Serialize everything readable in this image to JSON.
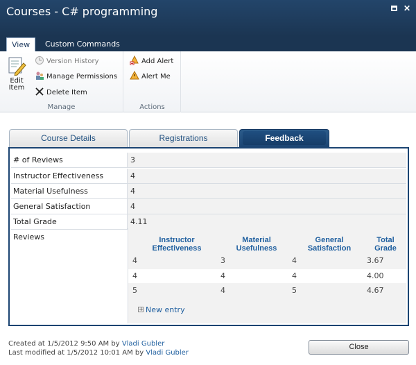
{
  "window": {
    "title": "Courses - C# programming"
  },
  "ribbon": {
    "tabs": [
      {
        "label": "View"
      },
      {
        "label": "Custom Commands"
      }
    ],
    "manage": {
      "edit_item": "Edit Item",
      "version_history": "Version History",
      "manage_permissions": "Manage Permissions",
      "delete_item": "Delete Item",
      "group_label": "Manage"
    },
    "actions": {
      "add_alert": "Add Alert",
      "alert_me": "Alert Me",
      "group_label": "Actions"
    }
  },
  "content_tabs": [
    {
      "label": "Course Details"
    },
    {
      "label": "Registrations"
    },
    {
      "label": "Feedback"
    }
  ],
  "fields": [
    {
      "label": "# of Reviews",
      "value": "3"
    },
    {
      "label": "Instructor Effectiveness",
      "value": "4"
    },
    {
      "label": "Material Usefulness",
      "value": "4"
    },
    {
      "label": "General Satisfaction",
      "value": "4"
    },
    {
      "label": "Total Grade",
      "value": "4.11"
    }
  ],
  "reviews": {
    "label": "Reviews",
    "headers": [
      "Instructor Effectiveness",
      "Material Usefulness",
      "General Satisfaction",
      "Total Grade"
    ],
    "rows": [
      [
        "4",
        "3",
        "4",
        "3.67"
      ],
      [
        "4",
        "4",
        "4",
        "4.00"
      ],
      [
        "5",
        "4",
        "5",
        "4.67"
      ]
    ],
    "new_entry": "New entry"
  },
  "footer": {
    "created_prefix": "Created at 1/5/2012 9:50 AM  by",
    "created_by": "Vladi Gubler",
    "modified_prefix": "Last modified at 1/5/2012 10:01 AM  by",
    "modified_by": "Vladi Gubler",
    "close_label": "Close"
  },
  "colors": {
    "title_bar": "#1b3552",
    "active_tab": "#1b4472",
    "link": "#1f5f9f"
  }
}
